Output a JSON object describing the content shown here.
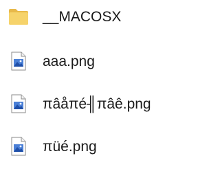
{
  "files": [
    {
      "name": "__MACOSX",
      "icon": "folder-icon"
    },
    {
      "name": "aaa.png",
      "icon": "image-file-icon"
    },
    {
      "name": "πâåπé╢πâê.png",
      "icon": "image-file-icon"
    },
    {
      "name": "πüé.png",
      "icon": "image-file-icon"
    }
  ],
  "colors": {
    "folder_fill": "#f6d36b",
    "folder_back": "#e8b94a",
    "file_page": "#ffffff",
    "file_border": "#8a8a8a",
    "image_sky": "#4a7fd6",
    "image_hill": "#1f4fa8"
  }
}
